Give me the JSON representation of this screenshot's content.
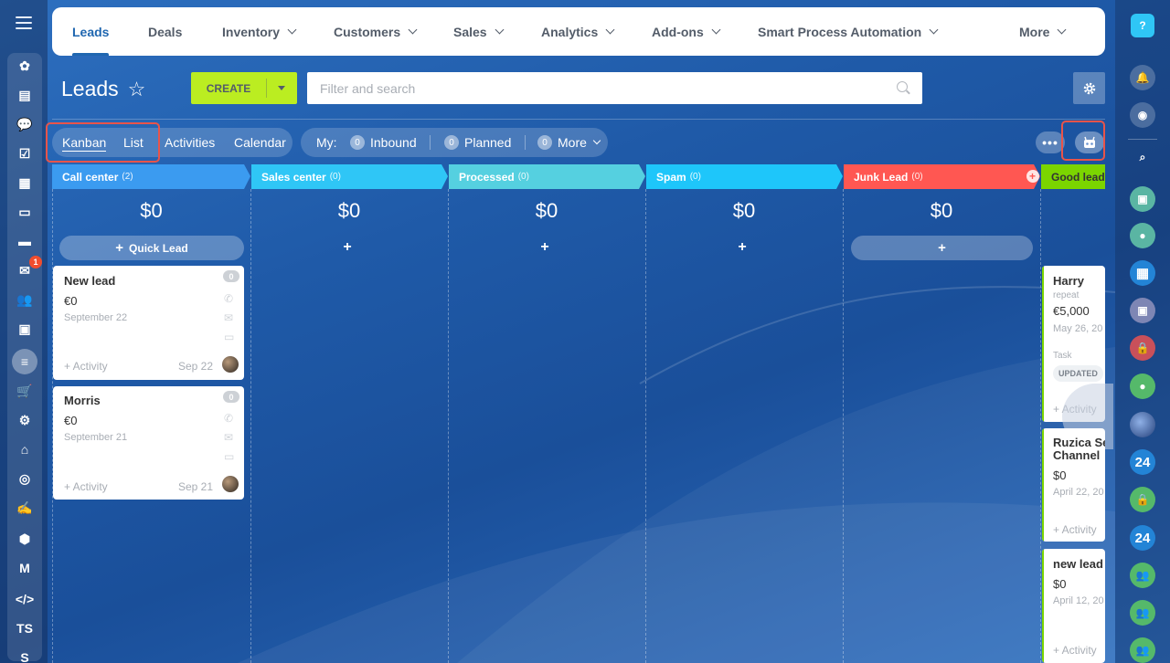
{
  "nav": {
    "items": [
      {
        "label": "Leads",
        "dropdown": false,
        "active": true
      },
      {
        "label": "Deals",
        "dropdown": false
      },
      {
        "label": "Inventory",
        "dropdown": true
      },
      {
        "label": "Customers",
        "dropdown": true
      },
      {
        "label": "Sales",
        "dropdown": true
      },
      {
        "label": "Analytics",
        "dropdown": true
      },
      {
        "label": "Add-ons",
        "dropdown": true
      },
      {
        "label": "Smart Process Automation",
        "dropdown": true
      },
      {
        "label": "More",
        "dropdown": true
      }
    ]
  },
  "header": {
    "title": "Leads",
    "create_label": "CREATE",
    "search_placeholder": "Filter and search"
  },
  "views": {
    "kanban": "Kanban",
    "list": "List",
    "activities": "Activities",
    "calendar": "Calendar"
  },
  "counters": {
    "my_label": "My:",
    "inbound": {
      "count": "0",
      "label": "Inbound"
    },
    "planned": {
      "count": "0",
      "label": "Planned"
    },
    "more": {
      "count": "0",
      "label": "More"
    }
  },
  "sidebar_left": {
    "mail_badge": "1",
    "initials_1": "TS",
    "initials_2": "S"
  },
  "sidebar_right": {
    "help": "?",
    "b24_1": "24",
    "b24_2": "24"
  },
  "columns": [
    {
      "name": "Call center",
      "count": "(2)",
      "sum": "$0",
      "color": "#3b9bf0",
      "quick": "Quick Lead"
    },
    {
      "name": "Sales center",
      "count": "(0)",
      "sum": "$0",
      "color": "#2fc6f6"
    },
    {
      "name": "Processed",
      "count": "(0)",
      "sum": "$0",
      "color": "#55d0e0"
    },
    {
      "name": "Spam",
      "count": "(0)",
      "sum": "$0",
      "color": "#1ec6fa"
    },
    {
      "name": "Junk Lead",
      "count": "(0)",
      "sum": "$0",
      "color": "#ff5752"
    },
    {
      "name": "Good lead",
      "count": "(",
      "color": "#7bd500"
    }
  ],
  "cards_col1": [
    {
      "title": "New lead",
      "price": "€0",
      "date": "September 22",
      "activity": "+ Activity",
      "right_date": "Sep 22",
      "count": "0"
    },
    {
      "title": "Morris",
      "price": "€0",
      "date": "September 21",
      "activity": "+ Activity",
      "right_date": "Sep 21",
      "count": "0"
    }
  ],
  "cards_good": [
    {
      "title": "Harry",
      "sub": "repeat",
      "price": "€5,000",
      "date": "May 26, 20",
      "task": "Task",
      "updated": "UPDATED",
      "activity": "+ Activity"
    },
    {
      "title": "Ruzica Sel",
      "title2": "Channel",
      "price": "$0",
      "date": "April 22, 20",
      "activity": "+ Activity"
    },
    {
      "title": "new lead",
      "price": "$0",
      "date": "April 12, 20",
      "activity": "+ Activity"
    }
  ],
  "colors": {
    "create_bg": "#bbed21",
    "highlight": "#e8544a",
    "nav_active": "#2067b0"
  }
}
